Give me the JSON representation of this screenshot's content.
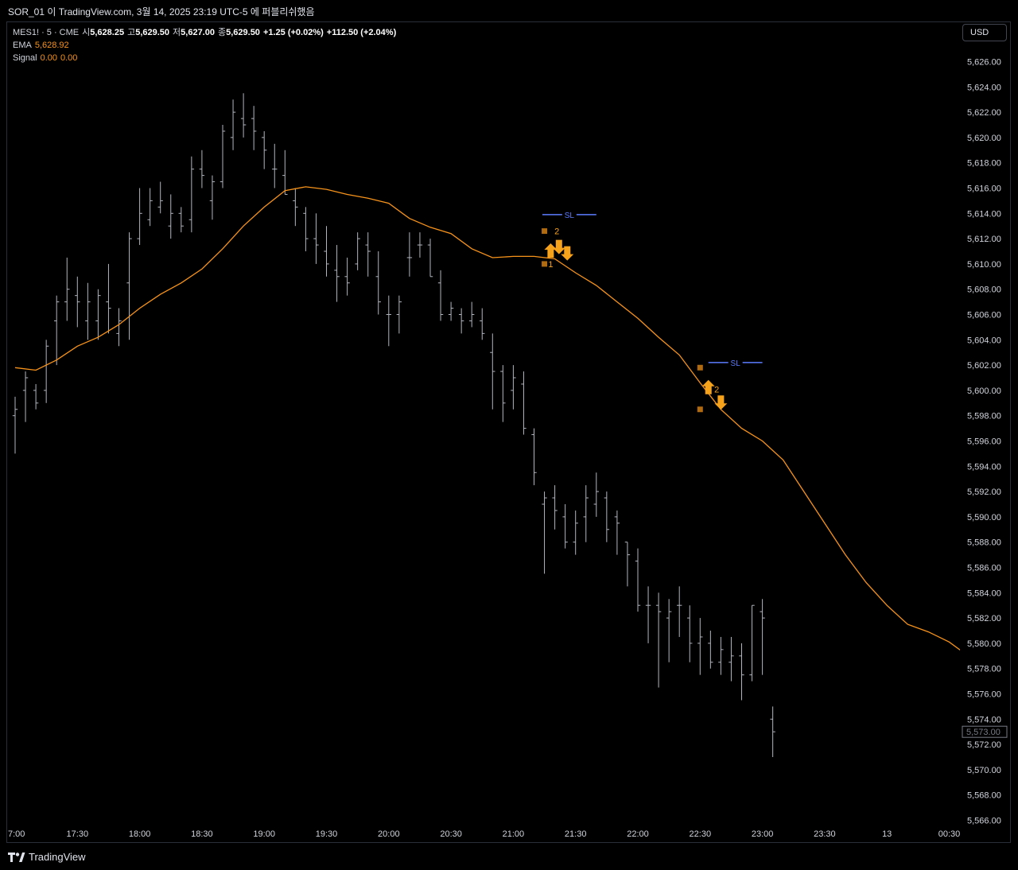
{
  "title_bar": {
    "text": "SOR_01 이 TradingView.com, 3월 14, 2025 23:19 UTC-5 에 퍼블리쉬했음"
  },
  "legend": {
    "symbol": "MES1! · 5 · CME",
    "open_label": "시",
    "open": "5,628.25",
    "high_label": "고",
    "high": "5,629.50",
    "low_label": "저",
    "low": "5,627.00",
    "close_label": "종",
    "close": "5,629.50",
    "change": "+1.25 (+0.02%)",
    "change2": "+112.50 (+2.04%)",
    "ema_label": "EMA",
    "ema_value": "5,628.92",
    "signal_label": "Signal",
    "signal_value1": "0.00",
    "signal_value2": "0.00"
  },
  "currency_button": "USD",
  "footer_brand": "TradingView",
  "colors": {
    "background": "#000000",
    "bars": "#b2b5be",
    "ema": "#f7931a",
    "sl_line": "#5b7cff",
    "signal_square": "#b06a10",
    "arrow": "#f7a21b"
  },
  "chart_data": {
    "type": "ohlc",
    "symbol": "MES1!",
    "interval": "5",
    "y_axis_labels": [
      "5,626.00",
      "5,624.00",
      "5,622.00",
      "5,620.00",
      "5,618.00",
      "5,616.00",
      "5,614.00",
      "5,612.00",
      "5,610.00",
      "5,608.00",
      "5,606.00",
      "5,604.00",
      "5,602.00",
      "5,600.00",
      "5,598.00",
      "5,596.00",
      "5,594.00",
      "5,592.00",
      "5,590.00",
      "5,588.00",
      "5,586.00",
      "5,584.00",
      "5,582.00",
      "5,580.00",
      "5,578.00",
      "5,576.00",
      "5,574.00",
      "5,572.00",
      "5,570.00",
      "5,568.00",
      "5,566.00"
    ],
    "y_ticks": [
      5626,
      5624,
      5622,
      5620,
      5618,
      5616,
      5614,
      5612,
      5610,
      5608,
      5606,
      5604,
      5602,
      5600,
      5598,
      5596,
      5594,
      5592,
      5590,
      5588,
      5586,
      5584,
      5582,
      5580,
      5578,
      5576,
      5574,
      5572,
      5570,
      5568,
      5566
    ],
    "ylim": [
      5565.6,
      5629.0
    ],
    "x_axis_labels": [
      {
        "label": "7:00",
        "time": 0
      },
      {
        "label": "17:30",
        "time": 30
      },
      {
        "label": "18:00",
        "time": 60
      },
      {
        "label": "18:30",
        "time": 90
      },
      {
        "label": "19:00",
        "time": 120
      },
      {
        "label": "19:30",
        "time": 150
      },
      {
        "label": "20:00",
        "time": 180
      },
      {
        "label": "20:30",
        "time": 210
      },
      {
        "label": "21:00",
        "time": 240
      },
      {
        "label": "21:30",
        "time": 270
      },
      {
        "label": "22:00",
        "time": 300
      },
      {
        "label": "22:30",
        "time": 330
      },
      {
        "label": "23:00",
        "time": 360
      },
      {
        "label": "23:30",
        "time": 390
      },
      {
        "label": "13",
        "time": 420
      },
      {
        "label": "00:30",
        "time": 450
      }
    ],
    "bars": [
      [
        5598.0,
        5599.5,
        5595.0,
        5598.5
      ],
      [
        5600.0,
        5601.5,
        5597.5,
        5601.0
      ],
      [
        5600.0,
        5600.5,
        5598.5,
        5599.0
      ],
      [
        5600.0,
        5604.0,
        5599.0,
        5603.5
      ],
      [
        5605.5,
        5607.5,
        5602.0,
        5607.0
      ],
      [
        5607.0,
        5610.5,
        5605.5,
        5608.0
      ],
      [
        5607.5,
        5609.0,
        5605.0,
        5607.0
      ],
      [
        5605.5,
        5608.5,
        5604.0,
        5607.0
      ],
      [
        5605.5,
        5608.0,
        5604.0,
        5607.5
      ],
      [
        5607.0,
        5610.0,
        5604.5,
        5606.5
      ],
      [
        5604.5,
        5606.5,
        5603.5,
        5605.5
      ],
      [
        5608.5,
        5612.5,
        5604.0,
        5612.0
      ],
      [
        5612.0,
        5616.0,
        5611.5,
        5614.0
      ],
      [
        5613.5,
        5616.0,
        5613.0,
        5615.0
      ],
      [
        5614.5,
        5616.5,
        5614.0,
        5615.0
      ],
      [
        5613.0,
        5615.5,
        5612.0,
        5614.0
      ],
      [
        5614.0,
        5614.5,
        5612.5,
        5613.0
      ],
      [
        5613.5,
        5618.5,
        5612.5,
        5617.5
      ],
      [
        5617.5,
        5619.0,
        5616.0,
        5617.0
      ],
      [
        5615.0,
        5617.0,
        5613.5,
        5616.5
      ],
      [
        5616.5,
        5621.0,
        5616.0,
        5620.5
      ],
      [
        5620.0,
        5623.0,
        5619.0,
        5622.0
      ],
      [
        5621.5,
        5623.5,
        5620.0,
        5621.0
      ],
      [
        5621.5,
        5622.5,
        5619.0,
        5620.5
      ],
      [
        5620.0,
        5620.5,
        5617.5,
        5619.0
      ],
      [
        5617.5,
        5619.5,
        5616.0,
        5617.5
      ],
      [
        5617.0,
        5619.0,
        5615.5,
        5615.5
      ],
      [
        5615.0,
        5616.0,
        5613.0,
        5614.5
      ],
      [
        5614.0,
        5614.5,
        5611.0,
        5612.0
      ],
      [
        5612.0,
        5614.0,
        5610.0,
        5611.5
      ],
      [
        5611.0,
        5613.0,
        5609.0,
        5610.0
      ],
      [
        5609.5,
        5611.5,
        5607.0,
        5609.0
      ],
      [
        5609.0,
        5610.5,
        5607.5,
        5608.5
      ],
      [
        5610.0,
        5612.5,
        5609.5,
        5612.0
      ],
      [
        5611.5,
        5612.5,
        5609.0,
        5611.0
      ],
      [
        5609.0,
        5611.0,
        5606.0,
        5607.0
      ],
      [
        5606.0,
        5607.5,
        5603.5,
        5606.0
      ],
      [
        5606.0,
        5607.5,
        5604.5,
        5607.0
      ],
      [
        5610.5,
        5612.5,
        5609.0,
        5610.5
      ],
      [
        5611.5,
        5612.5,
        5610.5,
        5611.5
      ],
      [
        5611.5,
        5612.0,
        5609.0,
        5609.0
      ],
      [
        5608.5,
        5609.5,
        5605.5,
        5606.0
      ],
      [
        5606.0,
        5607.0,
        5605.5,
        5606.5
      ],
      [
        5606.0,
        5606.5,
        5604.5,
        5605.5
      ],
      [
        5605.5,
        5607.0,
        5605.0,
        5606.0
      ],
      [
        5605.5,
        5606.5,
        5604.0,
        5604.5
      ],
      [
        5603.0,
        5604.5,
        5598.5,
        5601.5
      ],
      [
        5601.5,
        5602.0,
        5597.5,
        5599.0
      ],
      [
        5600.0,
        5602.0,
        5598.5,
        5601.0
      ],
      [
        5600.5,
        5601.5,
        5596.5,
        5597.0
      ],
      [
        5596.5,
        5597.0,
        5592.5,
        5593.5
      ],
      [
        5591.0,
        5592.0,
        5585.5,
        5591.5
      ],
      [
        5591.5,
        5592.5,
        5589.0,
        5590.5
      ],
      [
        5590.0,
        5591.0,
        5587.5,
        5588.0
      ],
      [
        5588.0,
        5590.5,
        5587.0,
        5589.5
      ],
      [
        5590.0,
        5592.5,
        5588.0,
        5591.5
      ],
      [
        5591.0,
        5593.5,
        5590.0,
        5592.0
      ],
      [
        5591.5,
        5592.0,
        5588.0,
        5589.0
      ],
      [
        5590.0,
        5590.5,
        5587.0,
        5589.5
      ],
      [
        5588.0,
        5588.0,
        5584.5,
        5587.0
      ],
      [
        5586.5,
        5587.5,
        5582.5,
        5583.0
      ],
      [
        5583.0,
        5584.5,
        5580.0,
        5583.0
      ],
      [
        5583.0,
        5584.0,
        5576.5,
        5582.5
      ],
      [
        5582.0,
        5583.5,
        5578.5,
        5582.5
      ],
      [
        5583.0,
        5584.5,
        5580.5,
        5583.0
      ],
      [
        5582.0,
        5583.0,
        5578.5,
        5580.0
      ],
      [
        5580.0,
        5582.0,
        5577.5,
        5580.5
      ],
      [
        5580.0,
        5581.0,
        5578.0,
        5578.5
      ],
      [
        5578.5,
        5580.5,
        5577.5,
        5579.5
      ],
      [
        5578.5,
        5580.5,
        5577.0,
        5579.0
      ],
      [
        5579.0,
        5580.0,
        5575.5,
        5577.5
      ],
      [
        5577.5,
        5583.0,
        5577.0,
        5583.0
      ],
      [
        5582.5,
        5583.5,
        5577.5,
        5582.0
      ],
      [
        5574.0,
        5575.0,
        5571.0,
        5573.0
      ]
    ],
    "last_price_label": "5,573.00",
    "ema": {
      "name": "EMA",
      "points": [
        [
          0,
          5601.8
        ],
        [
          10,
          5601.6
        ],
        [
          20,
          5602.4
        ],
        [
          30,
          5603.5
        ],
        [
          40,
          5604.2
        ],
        [
          50,
          5605.2
        ],
        [
          60,
          5606.5
        ],
        [
          70,
          5607.6
        ],
        [
          80,
          5608.5
        ],
        [
          90,
          5609.6
        ],
        [
          100,
          5611.2
        ],
        [
          110,
          5613.0
        ],
        [
          120,
          5614.5
        ],
        [
          130,
          5615.8
        ],
        [
          140,
          5616.1
        ],
        [
          150,
          5615.9
        ],
        [
          160,
          5615.5
        ],
        [
          170,
          5615.2
        ],
        [
          180,
          5614.8
        ],
        [
          190,
          5613.6
        ],
        [
          200,
          5612.9
        ],
        [
          210,
          5612.4
        ],
        [
          220,
          5611.2
        ],
        [
          230,
          5610.5
        ],
        [
          240,
          5610.6
        ],
        [
          250,
          5610.6
        ],
        [
          260,
          5610.4
        ],
        [
          270,
          5609.3
        ],
        [
          280,
          5608.3
        ],
        [
          290,
          5607.0
        ],
        [
          300,
          5605.7
        ],
        [
          310,
          5604.2
        ],
        [
          320,
          5602.8
        ],
        [
          330,
          5600.6
        ],
        [
          340,
          5598.5
        ],
        [
          350,
          5597.0
        ],
        [
          360,
          5596.0
        ],
        [
          370,
          5594.5
        ],
        [
          380,
          5592.0
        ],
        [
          390,
          5589.5
        ],
        [
          400,
          5587.0
        ],
        [
          410,
          5584.8
        ],
        [
          420,
          5583.0
        ],
        [
          430,
          5581.5
        ],
        [
          440,
          5580.9
        ],
        [
          450,
          5580.1
        ],
        [
          460,
          5578.9
        ]
      ]
    },
    "annotations": [
      {
        "label": "SL",
        "type": "stop_level",
        "price": 5613.9,
        "from": 254,
        "to": 280
      },
      {
        "label": "SL",
        "type": "stop_level",
        "price": 5602.2,
        "from": 334,
        "to": 360
      }
    ],
    "signal_marks": [
      {
        "type": "square",
        "time": 255,
        "price": 5612.6
      },
      {
        "type": "square",
        "time": 255,
        "price": 5610.0
      },
      {
        "type": "number",
        "text": "2",
        "time": 261,
        "price": 5612.6
      },
      {
        "type": "number",
        "text": "1",
        "time": 258,
        "price": 5610.0
      },
      {
        "type": "arrow_up",
        "time": 258,
        "price": 5611.0
      },
      {
        "type": "arrow_down",
        "time": 262,
        "price": 5611.4
      },
      {
        "type": "arrow_down",
        "time": 266,
        "price": 5610.9
      },
      {
        "type": "square",
        "time": 330,
        "price": 5601.8
      },
      {
        "type": "square",
        "time": 330,
        "price": 5598.5
      },
      {
        "type": "arrow_up",
        "time": 334,
        "price": 5600.2
      },
      {
        "type": "number",
        "text": "2",
        "time": 338,
        "price": 5600.1
      },
      {
        "type": "arrow_down",
        "time": 340,
        "price": 5599.1
      }
    ]
  }
}
